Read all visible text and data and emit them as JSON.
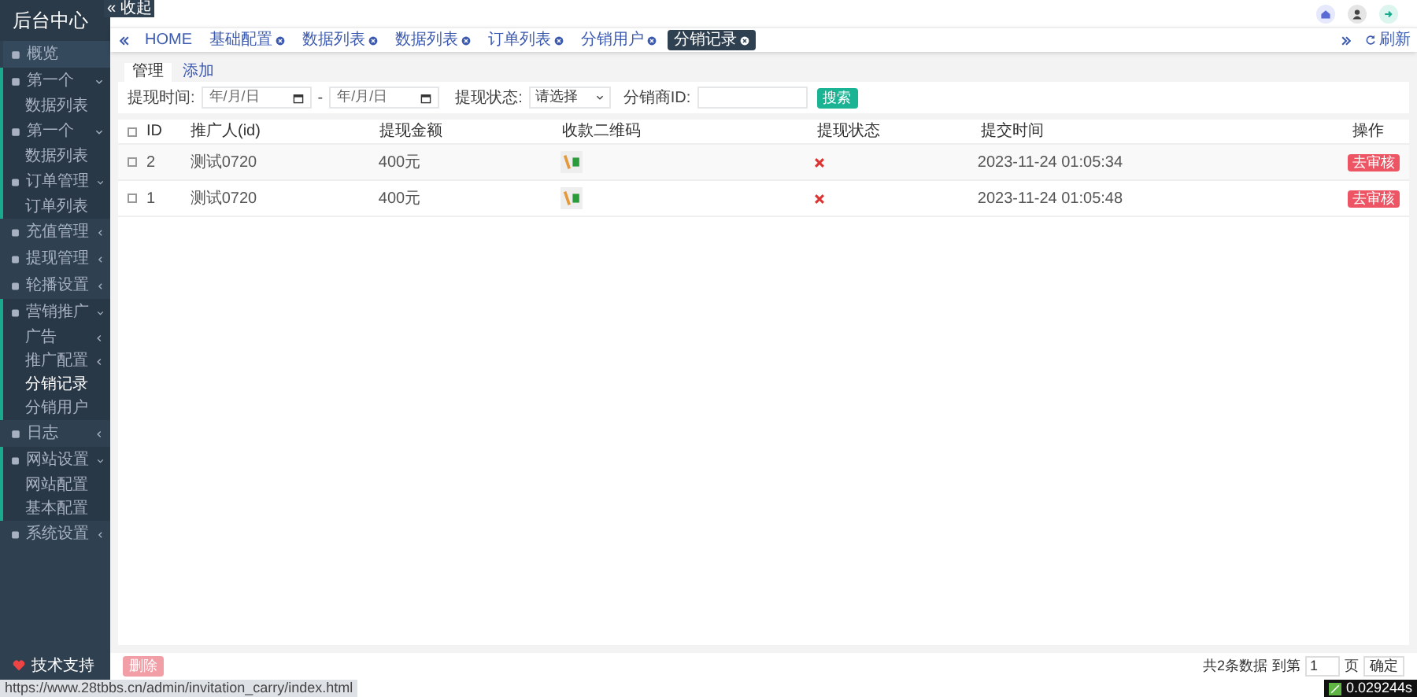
{
  "sidebar": {
    "title": "后台中心",
    "collapse_label": "« 收起",
    "items": [
      {
        "label": "概览",
        "expandable": false,
        "expanded": false
      },
      {
        "label": "第一个",
        "expandable": true,
        "expanded": true,
        "children": [
          {
            "label": "数据列表",
            "selected": false
          }
        ]
      },
      {
        "label": "第一个",
        "expandable": true,
        "expanded": true,
        "children": [
          {
            "label": "数据列表",
            "selected": false
          }
        ]
      },
      {
        "label": "订单管理",
        "expandable": true,
        "expanded": true,
        "children": [
          {
            "label": "订单列表",
            "selected": false
          }
        ]
      },
      {
        "label": "充值管理",
        "expandable": true,
        "expanded": false
      },
      {
        "label": "提现管理",
        "expandable": true,
        "expanded": false
      },
      {
        "label": "轮播设置",
        "expandable": true,
        "expanded": false
      },
      {
        "label": "营销推广",
        "expandable": true,
        "expanded": true,
        "children": [
          {
            "label": "广告",
            "selected": false,
            "expandable": true
          },
          {
            "label": "推广配置",
            "selected": false,
            "expandable": true
          },
          {
            "label": "分销记录",
            "selected": true,
            "expandable": false
          },
          {
            "label": "分销用户",
            "selected": false,
            "expandable": false
          }
        ]
      },
      {
        "label": "日志",
        "expandable": true,
        "expanded": false
      },
      {
        "label": "网站设置",
        "expandable": true,
        "expanded": true,
        "children": [
          {
            "label": "网站配置",
            "selected": false
          },
          {
            "label": "基本配置",
            "selected": false
          }
        ]
      },
      {
        "label": "系统设置",
        "expandable": true,
        "expanded": false
      }
    ],
    "footer": "技术支持"
  },
  "tabs": [
    {
      "label": "HOME",
      "selected": false,
      "closable": false
    },
    {
      "label": "基础配置",
      "selected": false,
      "closable": true
    },
    {
      "label": "数据列表",
      "selected": false,
      "closable": true
    },
    {
      "label": "数据列表",
      "selected": false,
      "closable": true
    },
    {
      "label": "订单列表",
      "selected": false,
      "closable": true
    },
    {
      "label": "分销用户",
      "selected": false,
      "closable": true
    },
    {
      "label": "分销记录",
      "selected": true,
      "closable": true
    }
  ],
  "refresh_label": "刷新",
  "sub_tabs": [
    {
      "label": "管理",
      "selected": true
    },
    {
      "label": "添加",
      "selected": false
    }
  ],
  "filters": {
    "time_label": "提现时间:",
    "date_from": {
      "placeholder": "年/月/日"
    },
    "date_to": {
      "placeholder": "年/月/日"
    },
    "separator": "-",
    "status_label": "提现状态:",
    "status_select": "请选择",
    "id_label": "分销商ID:",
    "search_button": "搜索"
  },
  "table": {
    "header_checked": false,
    "columns": [
      "ID",
      "推广人(id)",
      "提现金额",
      "收款二维码",
      "提现状态",
      "提交时间",
      "操作"
    ],
    "rows": [
      {
        "checked": false,
        "id": "2",
        "user": "测试0720",
        "amount": "400元",
        "status_ok": false,
        "time": "2023-11-24 01:05:34",
        "action": "去审核"
      },
      {
        "checked": false,
        "id": "1",
        "user": "测试0720",
        "amount": "400元",
        "status_ok": false,
        "time": "2023-11-24 01:05:48",
        "action": "去审核"
      }
    ]
  },
  "footer": {
    "delete_button": "删除",
    "total": "共2条数据",
    "goto_label": "到第",
    "page": "1",
    "page_unit": "页",
    "confirm_button": "确定"
  },
  "status_url": "https://www.28tbbs.cn/admin/invitation_carry/index.html",
  "debug_time": "0.029244s"
}
